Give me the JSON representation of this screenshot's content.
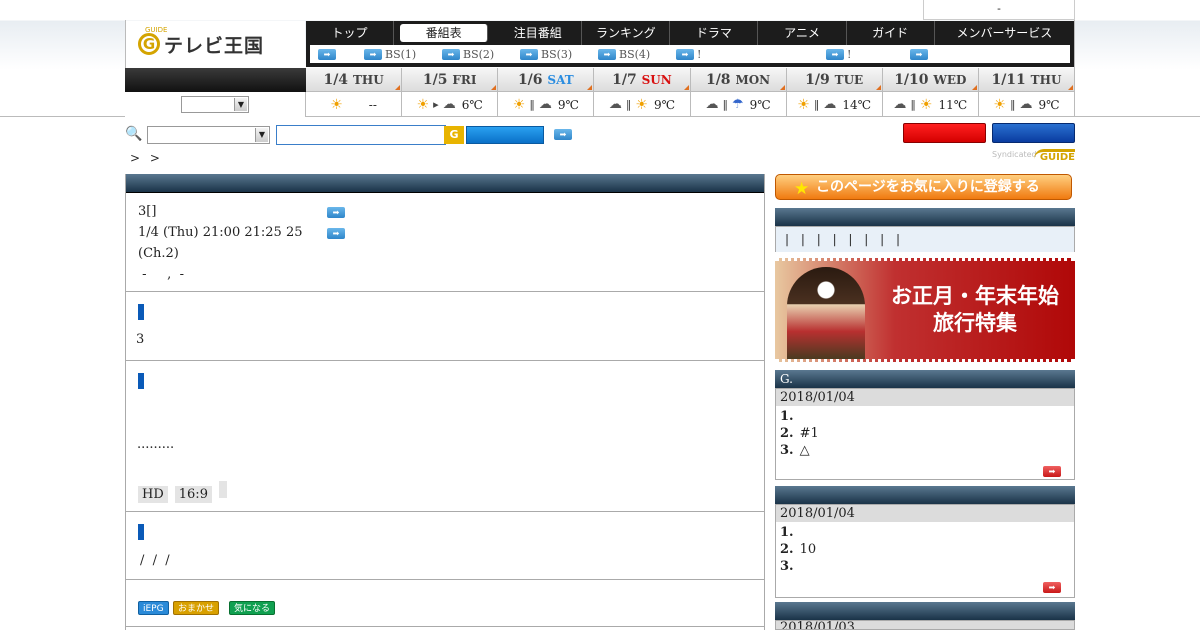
{
  "topbar": {
    "text": "-"
  },
  "logo": {
    "mark": "G",
    "guide": "GUIDE",
    "title": "テレビ王国"
  },
  "nav": {
    "tabs": [
      "トップ",
      "番組表",
      "注目番組",
      "ランキング",
      "ドラマ",
      "アニメ",
      "ガイド",
      "メンバーサービス"
    ],
    "active": "番組表",
    "sub": [
      "",
      "BS(1)",
      "BS(2)",
      "BS(3)",
      "BS(4)",
      "!",
      "!",
      ""
    ]
  },
  "weather": [
    {
      "date": "1/4",
      "dow": "THU",
      "icons": [
        "sun"
      ],
      "temp": "--"
    },
    {
      "date": "1/5",
      "dow": "FRI",
      "icons": [
        "sun",
        "to",
        "cloud"
      ],
      "temp": "6℃"
    },
    {
      "date": "1/6",
      "dow": "SAT",
      "icons": [
        "sun",
        "bar",
        "cloud"
      ],
      "temp": "9℃"
    },
    {
      "date": "1/7",
      "dow": "SUN",
      "icons": [
        "cloud",
        "bar",
        "sun"
      ],
      "temp": "9℃"
    },
    {
      "date": "1/8",
      "dow": "MON",
      "icons": [
        "cloud",
        "bar",
        "umbrella"
      ],
      "temp": "9℃"
    },
    {
      "date": "1/9",
      "dow": "TUE",
      "icons": [
        "sun",
        "bar",
        "cloud"
      ],
      "temp": "14℃"
    },
    {
      "date": "1/10",
      "dow": "WED",
      "icons": [
        "cloud",
        "bar",
        "sun"
      ],
      "temp": "11℃"
    },
    {
      "date": "1/11",
      "dow": "THU",
      "icons": [
        "sun",
        "bar",
        "cloud"
      ],
      "temp": "9℃"
    }
  ],
  "breadcrumb": "> >",
  "syndicated": "Syndicated",
  "program": {
    "line1": "3[]",
    "line2": "1/4 (Thu) 21:00  21:25 25",
    "line3": "(Ch.2)",
    "line4": " -     ,  -",
    "sec2_text": "3",
    "sec3_text": ".........",
    "tags": [
      "HD",
      "16:9",
      ""
    ],
    "sec4_text": "/  /  /",
    "pills": [
      "iEPG",
      "おまかせ",
      "気になる"
    ]
  },
  "sidebar": {
    "fav_label": "このページをお気に入りに登録する",
    "links": "| | | | | | | |",
    "banner_line1": "お正月・年末年始",
    "banner_line2": "旅行特集",
    "rank1_title": "G.",
    "rank1_date": "2018/01/04",
    "rank1_items": [
      "1.",
      "2.",
      "3."
    ],
    "rank1_texts": [
      "",
      "#1",
      "△"
    ],
    "rank2_date": "2018/01/04",
    "rank2_items": [
      "1.",
      "2.",
      "3."
    ],
    "rank2_texts": [
      "",
      "10",
      ""
    ],
    "rank3_date": "2018/01/03"
  },
  "colors": {
    "accent_blue": "#0a5ab8",
    "nav_bg": "#1c1c1c",
    "sat": "#2b8de0",
    "sun": "#d81010"
  }
}
